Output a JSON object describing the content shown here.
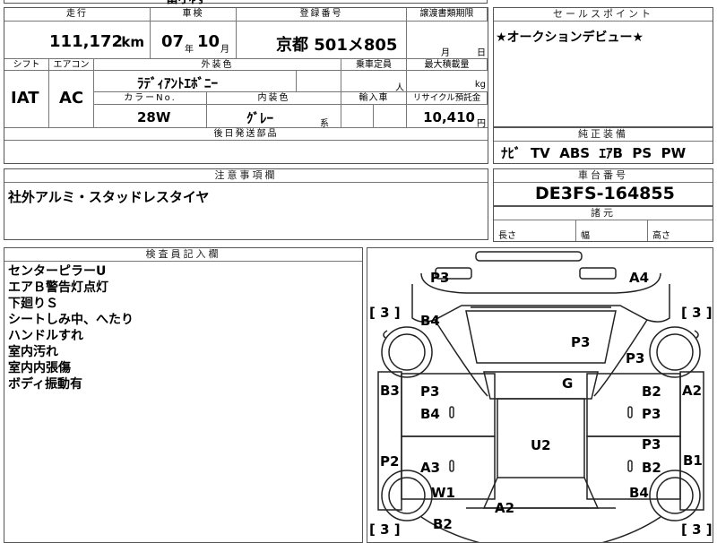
{
  "top_fragment": "富小内",
  "mileage": {
    "label": "走行",
    "value": "111,172",
    "unit": "km"
  },
  "inspection": {
    "label": "車検",
    "year": "07",
    "year_unit": "年",
    "month": "10",
    "month_unit": "月"
  },
  "registration": {
    "label": "登録番号",
    "value": "京都 501メ805"
  },
  "transfer_deadline": {
    "label": "譲渡書類期限",
    "month_unit": "月",
    "day_unit": "日"
  },
  "shift": {
    "label": "シフト",
    "value": "IAT"
  },
  "aircon": {
    "label": "エアコン",
    "value": "AC"
  },
  "exterior_color": {
    "label": "外装色",
    "value": "ﾗﾃﾞｨｱﾝﾄｴﾎﾞﾆｰ"
  },
  "capacity": {
    "label": "乗車定員",
    "unit": "人"
  },
  "max_load": {
    "label": "最大積載量",
    "unit": "kg"
  },
  "color_no": {
    "label": "カラーNo.",
    "value": "28W"
  },
  "interior_color": {
    "label": "内装色",
    "value": "ｸﾞﾚｰ",
    "suffix": "系"
  },
  "import": {
    "label": "輸入車"
  },
  "recycle": {
    "label": "リサイクル預託金",
    "value": "10,410",
    "unit": "円"
  },
  "shipping_parts": {
    "label": "後日発送部品"
  },
  "sales_point": {
    "label": "セールスポイント",
    "text": "★オークションデビュー★"
  },
  "genuine_equipment": {
    "label": "純正装備",
    "items": "ﾅﾋﾞ  TV  ABS  ｴｱB  PS  PW"
  },
  "notes": {
    "label": "注意事項欄",
    "text": "社外アルミ・スタッドレスタイヤ"
  },
  "chassis": {
    "label": "車台番号",
    "value": "DE3FS-164855"
  },
  "dimensions": {
    "label": "諸元",
    "length": "長さ",
    "width": "幅",
    "height": "高さ"
  },
  "inspector": {
    "label": "検査員記入欄",
    "lines": [
      "センターピラーU",
      "エアＢ警告灯点灯",
      "下廻りＳ",
      "シートしみ中、へたり",
      "ハンドルすれ",
      "室内汚れ",
      "室内内張傷",
      "ボディ振動有"
    ]
  },
  "diagram": {
    "marks": [
      "P3",
      "A4",
      "B4",
      "P3",
      "P3",
      "B3",
      "P3",
      "G",
      "B2",
      "A2",
      "B4",
      "P3",
      "U2",
      "P3",
      "P2",
      "A3",
      "B2",
      "B1",
      "W1",
      "B4",
      "A2",
      "B2"
    ],
    "brackets": [
      "[ 3 ]",
      "[ 3 ]",
      "[ 3 ]",
      "[ 3 ]"
    ]
  },
  "colors": {
    "border": "#555555",
    "header_bg": "#ffffff"
  }
}
